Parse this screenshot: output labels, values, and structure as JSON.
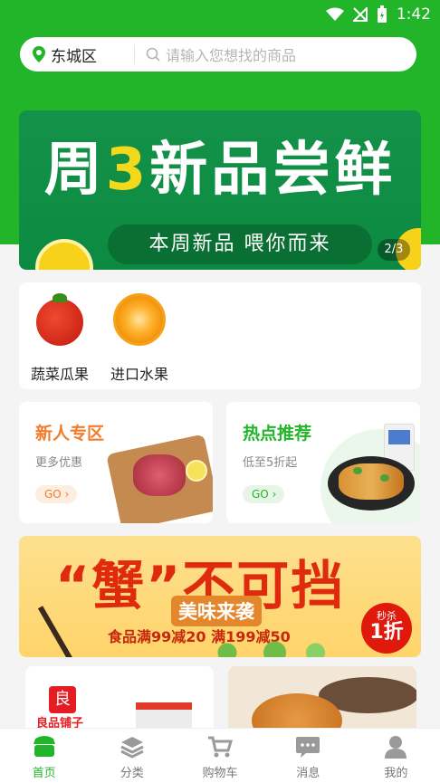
{
  "status_bar": {
    "time": "1:42"
  },
  "search": {
    "location": "东城区",
    "placeholder": "请输入您想找的商品"
  },
  "banner": {
    "title_part1": "周",
    "title_highlight": "3",
    "title_part2": "新品尝鲜",
    "subtitle": "本周新品  喂你而来",
    "counter": "2/3"
  },
  "categories": [
    {
      "label": "蔬菜瓜果",
      "icon": "tomato-icon"
    },
    {
      "label": "进口水果",
      "icon": "orange-icon"
    }
  ],
  "promos": [
    {
      "title": "新人专区",
      "subtitle": "更多优惠",
      "go": "GO",
      "title_color": "#f37b2b",
      "go_bg": "#fdeee2",
      "go_color": "#f37b2b"
    },
    {
      "title": "热点推荐",
      "subtitle": "低至5折起",
      "go": "GO",
      "title_color": "#22b529",
      "go_bg": "#e6f5e5",
      "go_color": "#22b529"
    }
  ],
  "crab_banner": {
    "title": "“蟹”不可挡",
    "subtitle": "美味来袭",
    "discount": "食品满99减20  满199减50",
    "badge_top": "秒杀",
    "badge_main": "1折"
  },
  "products": [
    {
      "shop_logo": "良",
      "shop_name": "良品铺子"
    }
  ],
  "tabbar": {
    "items": [
      {
        "label": "首页",
        "icon": "home-icon",
        "active": true
      },
      {
        "label": "分类",
        "icon": "category-icon",
        "active": false
      },
      {
        "label": "购物车",
        "icon": "cart-icon",
        "active": false
      },
      {
        "label": "消息",
        "icon": "message-icon",
        "active": false
      },
      {
        "label": "我的",
        "icon": "profile-icon",
        "active": false
      }
    ]
  },
  "colors": {
    "brand_green": "#22b529",
    "banner_green": "#14924a",
    "highlight_yellow": "#f3d91b"
  }
}
